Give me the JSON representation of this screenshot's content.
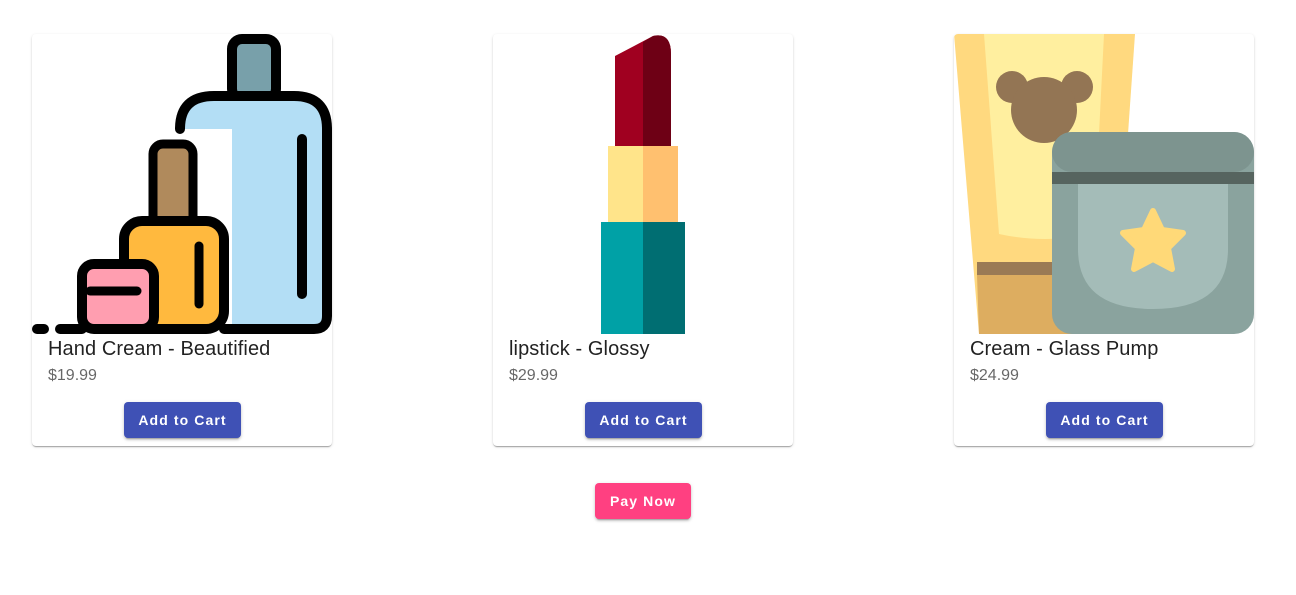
{
  "products": [
    {
      "title": "Hand Cream - Beautified",
      "price": "$19.99",
      "button_label": "Add to Cart",
      "image": "cosmetics-bottles-icon"
    },
    {
      "title": "lipstick - Glossy",
      "price": "$29.99",
      "button_label": "Add to Cart",
      "image": "lipstick-icon"
    },
    {
      "title": "Cream - Glass Pump",
      "price": "$24.99",
      "button_label": "Add to Cart",
      "image": "cream-tube-and-jar-icon"
    }
  ],
  "checkout": {
    "pay_label": "Pay Now"
  },
  "colors": {
    "primary": "#3f51b5",
    "accent": "#ff4081"
  }
}
